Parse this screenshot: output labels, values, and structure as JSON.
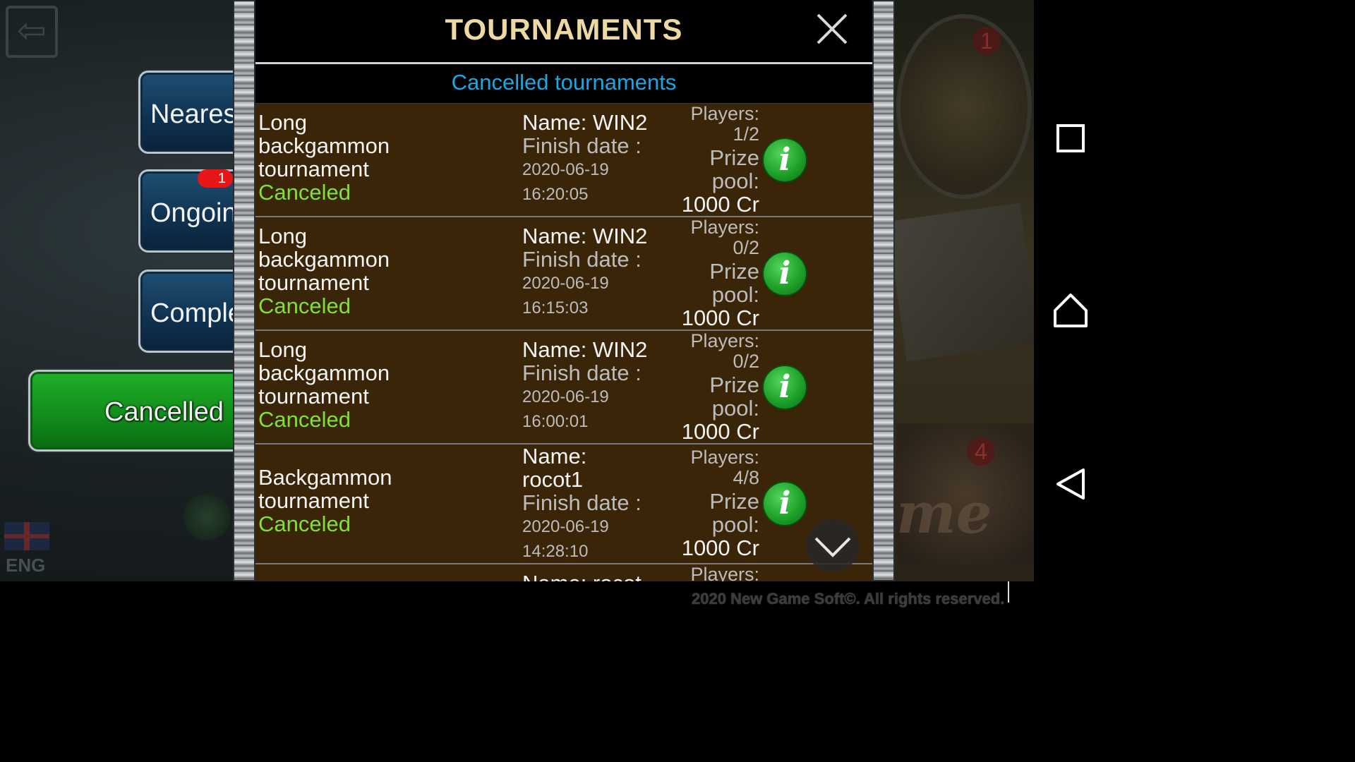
{
  "header": {
    "title": "TOURNAMENTS",
    "close_icon": "close-icon"
  },
  "subtitle": "Cancelled tournaments",
  "filters": {
    "nearest": "Neares",
    "ongoing": "Ongoin",
    "ongoing_badge": "1",
    "completed": "Comple",
    "cancelled": "Cancelled"
  },
  "background": {
    "language": "ENG",
    "badge_top": "1",
    "badge_bottom": "4",
    "watermark": "me"
  },
  "rows": [
    {
      "type": "Long backgammon tournament",
      "status": "Canceled",
      "name": "Name: WIN2",
      "finish_label": "Finish date :",
      "date": "2020-06-19",
      "time": "16:20:05",
      "players_label": "Players:",
      "players": "1/2",
      "prize_label_1": "Prize",
      "prize_label_2": "pool:",
      "prize": "1000 Cr"
    },
    {
      "type": "Long backgammon tournament",
      "status": "Canceled",
      "name": "Name: WIN2",
      "finish_label": "Finish date :",
      "date": "2020-06-19",
      "time": "16:15:03",
      "players_label": "Players:",
      "players": "0/2",
      "prize_label_1": "Prize",
      "prize_label_2": "pool:",
      "prize": "1000 Cr"
    },
    {
      "type": "Long backgammon tournament",
      "status": "Canceled",
      "name": "Name: WIN2",
      "finish_label": "Finish date :",
      "date": "2020-06-19",
      "time": "16:00:01",
      "players_label": "Players:",
      "players": "0/2",
      "prize_label_1": "Prize",
      "prize_label_2": "pool:",
      "prize": "1000 Cr"
    },
    {
      "type": "Backgammon tournament",
      "status": "Canceled",
      "name": "Name: rocot1",
      "finish_label": "Finish date :",
      "date": "2020-06-19",
      "time": "14:28:10",
      "players_label": "Players:",
      "players": "4/8",
      "prize_label_1": "Prize",
      "prize_label_2": "pool:",
      "prize": "1000 Cr"
    },
    {
      "name": "Name: rocot",
      "players_label": "Players:"
    }
  ],
  "info_glyph": "i",
  "footer": {
    "copyright": "2020 New Game Soft©. All rights reserved."
  },
  "colors": {
    "title": "#ecd9a4",
    "subtitle": "#17a8e6",
    "status_canceled": "#7fe03a",
    "row_bg": "#3a2508",
    "cancelled_button": "#20b02a"
  }
}
